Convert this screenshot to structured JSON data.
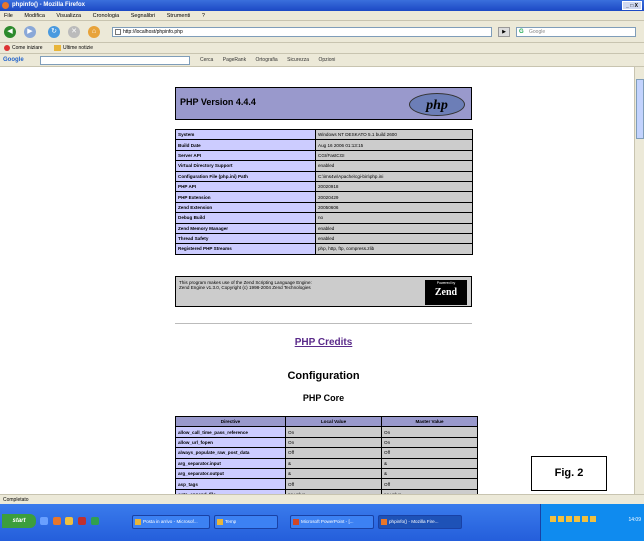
{
  "window": {
    "title": "phpinfo() - Mozilla Firefox",
    "controls": "_ □ X"
  },
  "menu": [
    "File",
    "Modifica",
    "Visualizza",
    "Cronologia",
    "Segnalibri",
    "Strumenti",
    "?"
  ],
  "address": {
    "url": "http://localhost/phpinfo.php",
    "search_placeholder": "Google"
  },
  "bookmarks": [
    "Come iniziare",
    "Ultime notizie"
  ],
  "google_toolbar": {
    "label": "Google",
    "items": [
      "Cerca",
      "PageRank",
      "Ortografia",
      "Sicurezza",
      "Opzioni"
    ]
  },
  "php": {
    "version": "PHP Version 4.4.4",
    "logo": "php"
  },
  "info_rows": [
    {
      "k": "System",
      "v": "Windows NT DESKATO 5.1 build 2600"
    },
    {
      "k": "Build Date",
      "v": "Aug 16 2006 01:13:15"
    },
    {
      "k": "Server API",
      "v": "CGI/FastCGI"
    },
    {
      "k": "Virtual Directory Support",
      "v": "enabled"
    },
    {
      "k": "Configuration File (php.ini) Path",
      "v": "C:\\ims4w\\Apache\\cgi-bin\\php.ini"
    },
    {
      "k": "PHP API",
      "v": "20020918"
    },
    {
      "k": "PHP Extension",
      "v": "20020429"
    },
    {
      "k": "Zend Extension",
      "v": "20050606"
    },
    {
      "k": "Debug Build",
      "v": "no"
    },
    {
      "k": "Zend Memory Manager",
      "v": "enabled"
    },
    {
      "k": "Thread Safety",
      "v": "enabled"
    },
    {
      "k": "Registered PHP Streams",
      "v": "php, http, ftp, compress.zlib"
    }
  ],
  "zend": {
    "line1": "This program makes use of the Zend Scripting Language Engine:",
    "line2": "Zend Engine v1.3.0, Copyright (c) 1998-2004 Zend Technologies",
    "powered": "Powered by",
    "logo": "Zend"
  },
  "credits": "PHP Credits",
  "config_title": "Configuration",
  "core_title": "PHP Core",
  "core_headers": [
    "Directive",
    "Local Value",
    "Master Value"
  ],
  "core_rows": [
    [
      "allow_call_time_pass_reference",
      "On",
      "On"
    ],
    [
      "allow_url_fopen",
      "On",
      "On"
    ],
    [
      "always_populate_raw_post_data",
      "Off",
      "Off"
    ],
    [
      "arg_separator.input",
      "&",
      "&"
    ],
    [
      "arg_separator.output",
      "&",
      "&"
    ],
    [
      "asp_tags",
      "Off",
      "Off"
    ],
    [
      "auto_append_file",
      "no value",
      "no value"
    ]
  ],
  "status": "Completato",
  "taskbar": {
    "start": "start",
    "buttons": [
      "Posta in arrivo - Microsof...",
      "Temp",
      "Microsoft PowerPoint - [...",
      "phpinfo() - Mozilla Fire..."
    ],
    "clock": "14:09"
  },
  "fig_label": "Fig. 2"
}
